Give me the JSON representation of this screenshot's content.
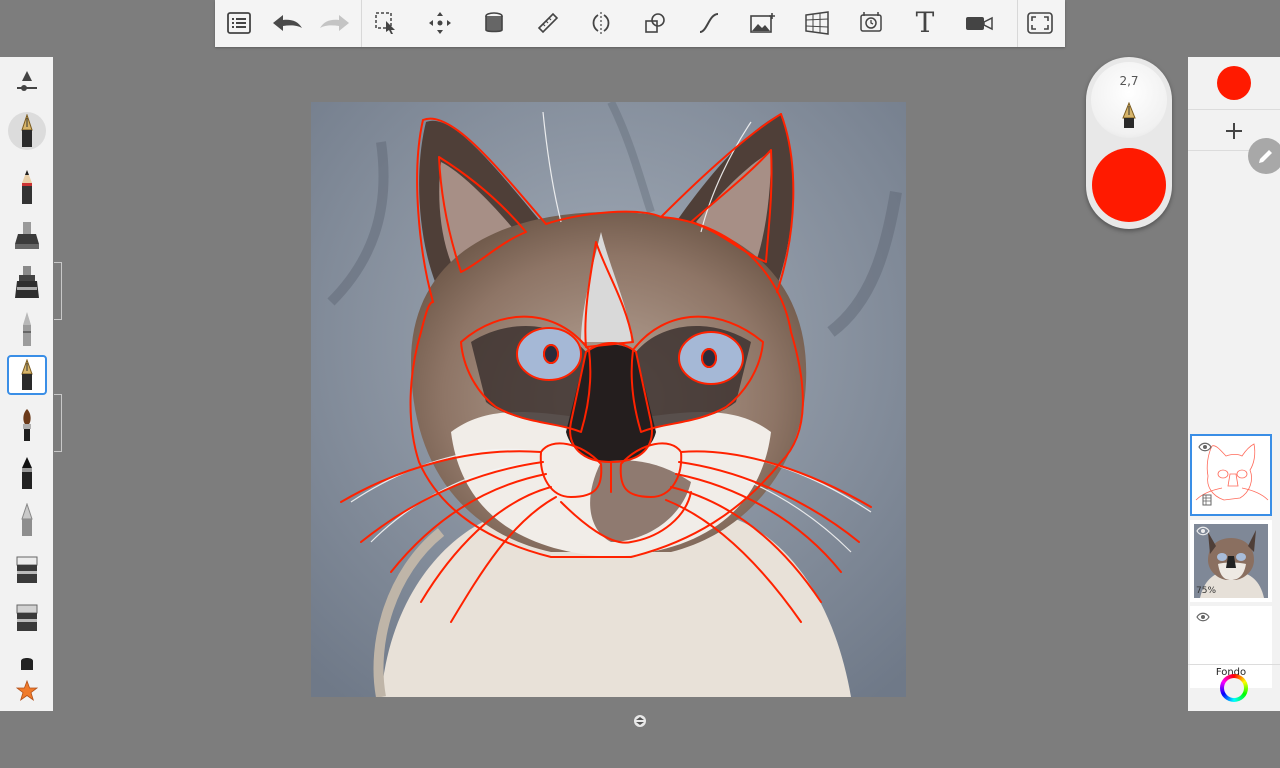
{
  "toolbar": {
    "items": [
      {
        "name": "gallery-menu-icon"
      },
      {
        "name": "undo-icon"
      },
      {
        "name": "redo-icon"
      },
      {
        "name": "selection-icon"
      },
      {
        "name": "transform-icon"
      },
      {
        "name": "fill-bucket-icon"
      },
      {
        "name": "ruler-icon"
      },
      {
        "name": "symmetry-icon"
      },
      {
        "name": "shapes-icon"
      },
      {
        "name": "curve-icon"
      },
      {
        "name": "add-image-icon"
      },
      {
        "name": "perspective-icon"
      },
      {
        "name": "time-lapse-icon"
      },
      {
        "name": "text-icon"
      },
      {
        "name": "video-icon"
      },
      {
        "name": "fullscreen-icon"
      }
    ],
    "text_tool_label": "T"
  },
  "brush_puck": {
    "size": "2,7",
    "color": "#ff1a00"
  },
  "layers": {
    "current_color": "#ff1a00",
    "items": [
      {
        "name": "sketch-layer",
        "opacity": "",
        "label": ""
      },
      {
        "name": "photo-layer",
        "opacity": "75%",
        "label": ""
      },
      {
        "name": "background-layer",
        "opacity": "",
        "label": "Fondo"
      }
    ]
  },
  "colors": {
    "accent": "#3a8ee6",
    "stroke": "#ff1a00",
    "workspace": "#7d7d7d"
  }
}
